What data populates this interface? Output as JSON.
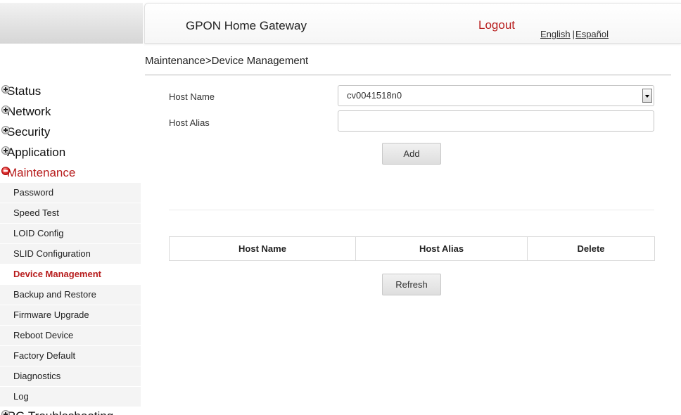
{
  "header": {
    "title": "GPON Home Gateway",
    "logout": "Logout",
    "lang_english": "English",
    "lang_sep": "|",
    "lang_spanish": "Español"
  },
  "breadcrumb": "Maintenance>Device Management",
  "nav": {
    "top_items": [
      {
        "label": "Status",
        "icon": "plus-icon"
      },
      {
        "label": "Network",
        "icon": "plus-icon"
      },
      {
        "label": "Security",
        "icon": "plus-icon"
      },
      {
        "label": "Application",
        "icon": "plus-icon"
      },
      {
        "label": "Maintenance",
        "icon": "minus-icon",
        "active": true
      }
    ],
    "sub_items": [
      "Password",
      "Speed Test",
      "LOID Config",
      "SLID Configuration",
      "Device Management",
      "Backup and Restore",
      "Firmware Upgrade",
      "Reboot Device",
      "Factory Default",
      "Diagnostics",
      "Log"
    ],
    "current_sub": "Device Management",
    "bottom_item": {
      "label": "RG Troubleshooting",
      "icon": "plus-icon"
    }
  },
  "form": {
    "host_name_label": "Host Name",
    "host_name_value": "cv0041518n0",
    "host_alias_label": "Host Alias",
    "host_alias_value": "",
    "add_button": "Add"
  },
  "table": {
    "columns": [
      "Host Name",
      "Host Alias",
      "Delete"
    ],
    "rows": []
  },
  "refresh_button": "Refresh",
  "colors": {
    "accent_red": "#b71c1c",
    "sidebar_bg": "#f4f4f4"
  }
}
